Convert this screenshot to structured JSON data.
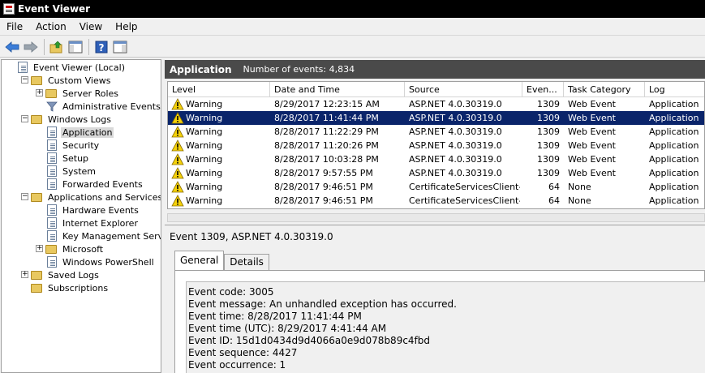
{
  "window": {
    "title": "Event Viewer"
  },
  "menu": [
    "File",
    "Action",
    "View",
    "Help"
  ],
  "toolbar": [
    "back-arrow-icon",
    "forward-arrow-icon",
    "up-folder-icon",
    "show-hide-tree-icon",
    "help-icon",
    "action-pane-icon"
  ],
  "tree": {
    "items": [
      {
        "label": "Event Viewer (Local)",
        "level": 0,
        "expander": "",
        "icon": "logicon"
      },
      {
        "label": "Custom Views",
        "level": 1,
        "expander": "−",
        "icon": "folder"
      },
      {
        "label": "Server Roles",
        "level": 2,
        "expander": "+",
        "icon": "folder"
      },
      {
        "label": "Administrative Events",
        "level": 2,
        "expander": "",
        "icon": "filter"
      },
      {
        "label": "Windows Logs",
        "level": 1,
        "expander": "−",
        "icon": "folder"
      },
      {
        "label": "Application",
        "level": 2,
        "expander": "",
        "icon": "logicon",
        "selected": true
      },
      {
        "label": "Security",
        "level": 2,
        "expander": "",
        "icon": "logicon"
      },
      {
        "label": "Setup",
        "level": 2,
        "expander": "",
        "icon": "logicon"
      },
      {
        "label": "System",
        "level": 2,
        "expander": "",
        "icon": "logicon"
      },
      {
        "label": "Forwarded Events",
        "level": 2,
        "expander": "",
        "icon": "logicon"
      },
      {
        "label": "Applications and Services Logs",
        "level": 1,
        "expander": "−",
        "icon": "folder"
      },
      {
        "label": "Hardware Events",
        "level": 2,
        "expander": "",
        "icon": "logicon"
      },
      {
        "label": "Internet Explorer",
        "level": 2,
        "expander": "",
        "icon": "logicon"
      },
      {
        "label": "Key Management Service",
        "level": 2,
        "expander": "",
        "icon": "logicon"
      },
      {
        "label": "Microsoft",
        "level": 2,
        "expander": "+",
        "icon": "folder"
      },
      {
        "label": "Windows PowerShell",
        "level": 2,
        "expander": "",
        "icon": "logicon"
      },
      {
        "label": "Saved Logs",
        "level": 1,
        "expander": "+",
        "icon": "folder"
      },
      {
        "label": "Subscriptions",
        "level": 1,
        "expander": "",
        "icon": "folder"
      }
    ]
  },
  "header": {
    "title": "Application",
    "count": "Number of events: 4,834"
  },
  "grid": {
    "columns": [
      "Level",
      "Date and Time",
      "Source",
      "Even...",
      "Task Category",
      "Log"
    ],
    "rows": [
      {
        "level": "Warning",
        "date": "8/29/2017 12:23:15 AM",
        "source": "ASP.NET 4.0.30319.0",
        "event": "1309",
        "task": "Web Event",
        "log": "Application"
      },
      {
        "level": "Warning",
        "date": "8/28/2017 11:41:44 PM",
        "source": "ASP.NET 4.0.30319.0",
        "event": "1309",
        "task": "Web Event",
        "log": "Application",
        "selected": true
      },
      {
        "level": "Warning",
        "date": "8/28/2017 11:22:29 PM",
        "source": "ASP.NET 4.0.30319.0",
        "event": "1309",
        "task": "Web Event",
        "log": "Application"
      },
      {
        "level": "Warning",
        "date": "8/28/2017 11:20:26 PM",
        "source": "ASP.NET 4.0.30319.0",
        "event": "1309",
        "task": "Web Event",
        "log": "Application"
      },
      {
        "level": "Warning",
        "date": "8/28/2017 10:03:28 PM",
        "source": "ASP.NET 4.0.30319.0",
        "event": "1309",
        "task": "Web Event",
        "log": "Application"
      },
      {
        "level": "Warning",
        "date": "8/28/2017 9:57:55 PM",
        "source": "ASP.NET 4.0.30319.0",
        "event": "1309",
        "task": "Web Event",
        "log": "Application"
      },
      {
        "level": "Warning",
        "date": "8/28/2017 9:46:51 PM",
        "source": "CertificateServicesClient-...",
        "event": "64",
        "task": "None",
        "log": "Application"
      },
      {
        "level": "Warning",
        "date": "8/28/2017 9:46:51 PM",
        "source": "CertificateServicesClient-...",
        "event": "64",
        "task": "None",
        "log": "Application"
      }
    ]
  },
  "detail": {
    "title": "Event 1309, ASP.NET 4.0.30319.0",
    "tabs": [
      "General",
      "Details"
    ],
    "lines": [
      "Event code: 3005",
      "Event message: An unhandled exception has occurred.",
      "Event time: 8/28/2017 11:41:44 PM",
      "Event time (UTC): 8/29/2017 4:41:44 AM",
      "Event ID: 15d1d0434d9d4066a0e9d078b89c4fbd",
      "Event sequence: 4427",
      "Event occurrence: 1"
    ]
  },
  "colors": {
    "header_bg": "#4a4a4a",
    "selection": "#0a246a",
    "warning": "#f5d20a"
  }
}
